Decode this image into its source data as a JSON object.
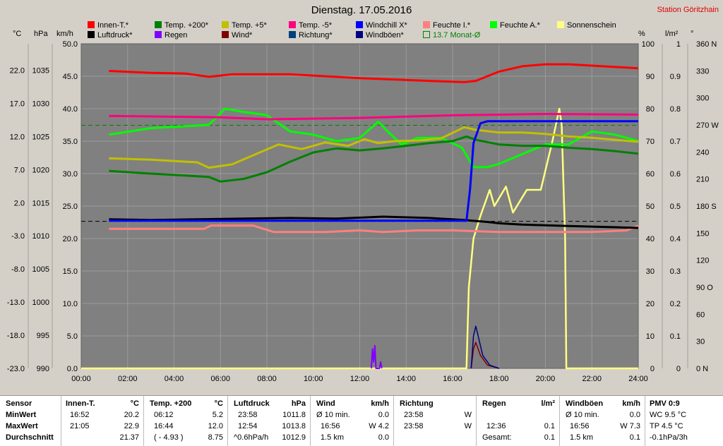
{
  "header": {
    "title": "Dienstag. 17.05.2016",
    "station": "Station Göritzhain"
  },
  "legend": [
    {
      "label": "Innen-T.*",
      "color": "#ff0000"
    },
    {
      "label": "Temp. +200*",
      "color": "#008000"
    },
    {
      "label": "Temp. +5*",
      "color": "#c0c000"
    },
    {
      "label": "Temp. -5*",
      "color": "#ff0080"
    },
    {
      "label": "Windchill X*",
      "color": "#0000ff"
    },
    {
      "label": "Feuchte I.*",
      "color": "#ff8080"
    },
    {
      "label": "Feuchte A.*",
      "color": "#00ff00"
    },
    {
      "label": "Sonnenschein",
      "color": "#ffff80"
    },
    {
      "label": "Luftdruck*",
      "color": "#000000"
    },
    {
      "label": "Regen",
      "color": "#8000ff"
    },
    {
      "label": "Wind*",
      "color": "#800000"
    },
    {
      "label": "Richtung*",
      "color": "#004080"
    },
    {
      "label": "Windböen*",
      "color": "#000080"
    },
    {
      "label": "13.7 Monat-Ø",
      "color": "#008000"
    }
  ],
  "units": {
    "temp": "°C",
    "press": "hPa",
    "wind": "km/h",
    "hum": "%",
    "rain": "l/m²",
    "dir": "°"
  },
  "chart_data": {
    "type": "line",
    "x_ticks": [
      "00:00",
      "02:00",
      "04:00",
      "06:00",
      "08:00",
      "10:00",
      "12:00",
      "14:00",
      "16:00",
      "18:00",
      "20:00",
      "22:00",
      "24:00"
    ],
    "x_range_hours": [
      0,
      24
    ],
    "axes": {
      "temp_ticks": [
        "22.0",
        "17.0",
        "12.0",
        "7.0",
        "2.0",
        "-3.0",
        "-8.0",
        "-13.0",
        "-18.0",
        "-23.0"
      ],
      "press_ticks": [
        "1035",
        "1030",
        "1025",
        "1020",
        "1015",
        "1010",
        "1005",
        "1000",
        "995",
        "990"
      ],
      "wind_ticks": [
        "50.0",
        "45.0",
        "40.0",
        "35.0",
        "30.0",
        "25.0",
        "20.0",
        "15.0",
        "10.0",
        "5.0",
        "0.0"
      ],
      "hum_ticks": [
        "100",
        "90",
        "80",
        "70",
        "60",
        "50",
        "40",
        "30",
        "20",
        "10",
        "0"
      ],
      "rain_ticks": [
        "1",
        "0.9",
        "0.8",
        "0.7",
        "0.6",
        "0.5",
        "0.4",
        "0.3",
        "0.2",
        "0.1",
        "0"
      ],
      "dir_ticks": [
        "360 N",
        "330",
        "300",
        "270 W",
        "240",
        "210",
        "180 S",
        "150",
        "120",
        "90 O",
        "60",
        "30",
        "0 N"
      ],
      "temp_range": [
        -23,
        26
      ],
      "press_range": [
        990,
        1039
      ],
      "wind_range": [
        0,
        50
      ],
      "hum_range": [
        0,
        100
      ]
    },
    "series": [
      {
        "name": "Innen-T.*",
        "axis": "temp",
        "color": "#ff0000",
        "x": [
          1.2,
          3,
          4.5,
          5.5,
          6.5,
          9,
          12,
          15,
          16.5,
          17,
          18,
          19,
          20,
          21,
          22,
          23,
          24
        ],
        "y": [
          21.9,
          21.6,
          21.5,
          21.0,
          21.4,
          21.4,
          20.8,
          20.4,
          20.2,
          20.4,
          21.8,
          22.6,
          22.9,
          22.9,
          22.7,
          22.5,
          22.3
        ]
      },
      {
        "name": "Temp. +200*",
        "axis": "temp",
        "color": "#008000",
        "x": [
          1.2,
          3,
          5.5,
          6,
          7,
          8,
          9,
          10,
          11,
          12,
          13,
          14,
          15,
          16,
          16.6,
          17,
          18,
          19,
          20,
          21,
          22,
          23,
          24
        ],
        "y": [
          6.8,
          6.4,
          5.9,
          5.2,
          5.6,
          6.6,
          8.2,
          9.6,
          10.2,
          9.9,
          10.2,
          10.6,
          11.0,
          11.3,
          12.0,
          11.5,
          10.8,
          10.6,
          10.6,
          10.3,
          10.1,
          9.8,
          9.4
        ]
      },
      {
        "name": "Temp. +5*",
        "axis": "temp",
        "color": "#c0c000",
        "x": [
          1.2,
          3,
          5,
          5.5,
          6.5,
          7.5,
          8.5,
          9.5,
          10.5,
          11.5,
          12.2,
          12.8,
          13.5,
          14.5,
          15.5,
          16.5,
          17,
          18,
          19,
          20,
          21,
          22,
          23,
          24
        ],
        "y": [
          8.7,
          8.5,
          8.1,
          7.3,
          7.8,
          9.3,
          10.8,
          10.1,
          11.1,
          10.6,
          11.6,
          11.0,
          11.3,
          11.4,
          11.7,
          13.4,
          13.0,
          12.6,
          12.6,
          12.4,
          12.0,
          11.8,
          11.5,
          11.2
        ]
      },
      {
        "name": "Temp. -5*",
        "axis": "temp",
        "color": "#ff0080",
        "x": [
          1.2,
          6,
          8,
          12,
          16,
          20,
          24
        ],
        "y": [
          15.1,
          14.9,
          14.6,
          14.8,
          15.2,
          15.4,
          15.3
        ]
      },
      {
        "name": "Windchill X*",
        "axis": "temp",
        "color": "#0000ff",
        "x": [
          1.2,
          16.6,
          16.75,
          16.9,
          17.2,
          17.5,
          24
        ],
        "y": [
          -0.7,
          -0.7,
          4,
          11,
          14,
          14.3,
          14.3
        ]
      },
      {
        "name": "Luftdruck*",
        "axis": "press",
        "color": "#000000",
        "x": [
          1.2,
          3,
          5,
          7,
          9,
          11,
          13,
          15,
          16.5,
          17.5,
          18,
          19,
          20,
          21,
          22,
          23,
          24
        ],
        "y": [
          1012.5,
          1012.4,
          1012.5,
          1012.6,
          1012.7,
          1012.6,
          1012.9,
          1012.7,
          1012.4,
          1012.1,
          1011.9,
          1011.7,
          1011.6,
          1011.5,
          1011.4,
          1011.3,
          1011.2
        ]
      },
      {
        "name": "Feuchte I.*",
        "axis": "hum",
        "color": "#ff8080",
        "x": [
          1.2,
          5.3,
          5.6,
          7.4,
          8.3,
          10.5,
          12,
          13,
          14.5,
          16,
          18,
          20,
          22,
          23.5,
          24
        ],
        "y": [
          43,
          43,
          44,
          44,
          42,
          42,
          42.5,
          42,
          42.5,
          42.5,
          42,
          42,
          42,
          42.5,
          44
        ]
      },
      {
        "name": "Feuchte A.*",
        "axis": "hum",
        "color": "#00ff00",
        "x": [
          1.2,
          3,
          5.5,
          6.2,
          7,
          8,
          9,
          10,
          11,
          12,
          12.8,
          13.2,
          13.8,
          14.5,
          15.5,
          16.4,
          16.9,
          17.5,
          18,
          19,
          20,
          21,
          22,
          23,
          24
        ],
        "y": [
          72,
          74,
          75,
          80,
          79,
          78,
          73,
          72,
          70,
          71,
          76,
          73,
          69,
          71,
          71,
          68,
          62,
          62,
          63,
          66,
          69,
          69,
          73,
          72,
          70
        ]
      },
      {
        "name": "Sonnenschein",
        "axis": "rain",
        "color": "#ffff80",
        "x": [
          0,
          16.6,
          16.7,
          16.9,
          17.2,
          17.6,
          17.8,
          18.3,
          18.6,
          19.2,
          19.8,
          20.3,
          20.6,
          20.7,
          20.85,
          20.9,
          24
        ],
        "y": [
          0,
          0,
          0.25,
          0.4,
          0.47,
          0.55,
          0.5,
          0.56,
          0.48,
          0.55,
          0.55,
          0.7,
          0.8,
          0.75,
          0.4,
          0,
          0
        ]
      },
      {
        "name": "Regen",
        "axis": "rain",
        "color": "#8000ff",
        "x": [
          12.5,
          12.55,
          12.6,
          12.65,
          12.7,
          12.85,
          12.9,
          12.95
        ],
        "y": [
          0,
          0.06,
          0.02,
          0.07,
          0,
          0,
          0.02,
          0
        ]
      },
      {
        "name": "Wind*",
        "axis": "wind",
        "color": "#800000",
        "x": [
          16.8,
          16.9,
          17.0,
          17.2,
          17.5,
          18
        ],
        "y": [
          0,
          3,
          4,
          2,
          0.5,
          0
        ]
      },
      {
        "name": "Windböen*",
        "axis": "wind",
        "color": "#000080",
        "x": [
          16.8,
          16.9,
          17.0,
          17.3,
          17.6,
          18
        ],
        "y": [
          0,
          5,
          6.5,
          2,
          0.5,
          0
        ]
      }
    ],
    "reference_lines": [
      {
        "name": "13.7 Monat-Ø",
        "axis": "temp",
        "y": 13.7,
        "color": "#008000",
        "dashed": true
      },
      {
        "axis": "press",
        "y": 1012.2,
        "color": "#000000",
        "dashed": true
      }
    ]
  },
  "stats": {
    "sensor": {
      "h": "Sensor",
      "r": [
        "MinWert",
        "MaxWert",
        "Durchschnitt"
      ]
    },
    "innen": {
      "h": "Innen-T.",
      "u": "°C",
      "t": [
        "16:52",
        "21:05",
        ""
      ],
      "v": [
        "20.2",
        "22.9",
        "21.37"
      ]
    },
    "temp": {
      "h": "Temp. +200",
      "u": "°C",
      "t": [
        "06:12",
        "16:44",
        "( - 4.93 )"
      ],
      "v": [
        "5.2",
        "12.0",
        "8.75"
      ]
    },
    "druck": {
      "h": "Luftdruck",
      "u": "hPa",
      "t": [
        "23:58",
        "12:54",
        "^0.6hPa/h"
      ],
      "v": [
        "1011.8",
        "1013.8",
        "1012.9"
      ]
    },
    "wind": {
      "h": "Wind",
      "u": "km/h",
      "t": [
        "Ø 10 min.",
        "16:56",
        "1.5 km"
      ],
      "v": [
        "0.0",
        "W 4.2",
        "0.0"
      ]
    },
    "richtung": {
      "h": "Richtung",
      "t": [
        "23:58",
        "23:58",
        ""
      ],
      "v": [
        "W",
        "W",
        ""
      ]
    },
    "regen": {
      "h": "Regen",
      "u": "l/m²",
      "t": [
        "",
        "12:36",
        "Gesamt:"
      ],
      "v": [
        "",
        "0.1",
        "0.1"
      ]
    },
    "boeen": {
      "h": "Windböen",
      "u": "km/h",
      "t": [
        "Ø 10 min.",
        "16:56",
        "1.5 km"
      ],
      "v": [
        "0.0",
        "W 7.3",
        "0.1"
      ]
    },
    "pmv": {
      "h": "PMV 0:9",
      "r": [
        "WC 9.5 °C",
        "TP 4.5 °C",
        "-0.1hPa/3h"
      ]
    }
  }
}
